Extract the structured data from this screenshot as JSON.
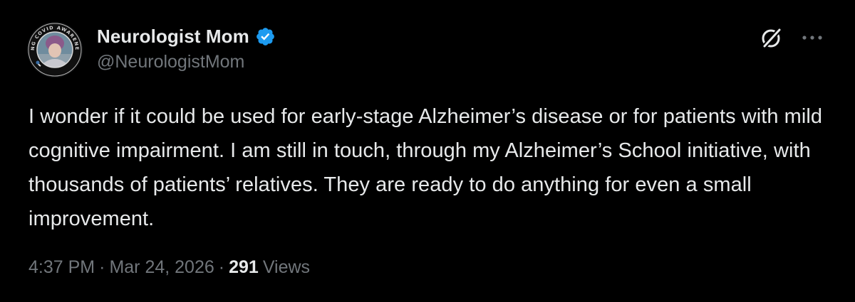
{
  "author": {
    "display_name": "Neurologist Mom",
    "handle": "@NeurologistMom",
    "verified": true,
    "avatar_badge_text": "LONG COVID AWARENESS"
  },
  "actions": {
    "grok_icon": "grok-icon",
    "more_icon": "more-icon"
  },
  "tweet": {
    "text": "I wonder if it could be used for early-stage Alzheimer’s disease or for patients with mild cognitive impairment. I am still in touch, through my Alzheimer’s School initiative, with thousands of patients’ relatives. They are ready to do anything for even a small improvement."
  },
  "meta": {
    "time": "4:37 PM",
    "date": "Mar 24, 2026",
    "separator": "·",
    "views_count": "291",
    "views_label": "Views"
  },
  "colors": {
    "background": "#000000",
    "primary_text": "#e7e9ea",
    "secondary_text": "#71767b",
    "verified_blue": "#1d9bf0"
  }
}
